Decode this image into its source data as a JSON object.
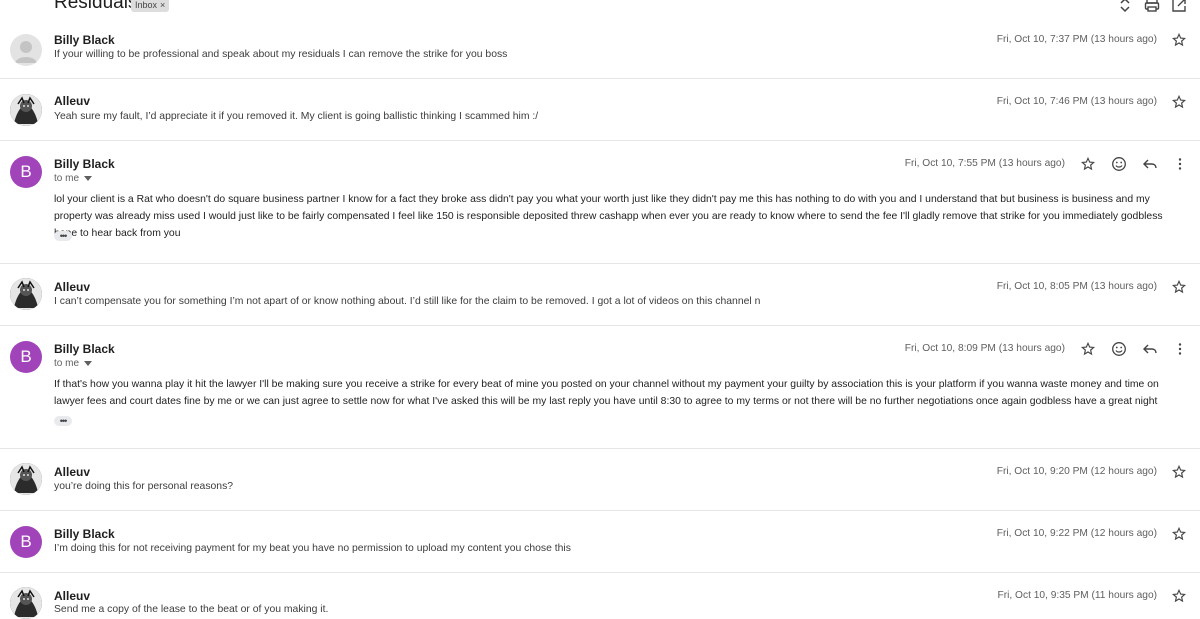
{
  "thread": {
    "subject": "Residuals",
    "label": "Inbox",
    "label_close": "×"
  },
  "icons": {
    "expand": "unfold-icon",
    "print": "print-icon",
    "open_new": "open-in-new-window-icon",
    "star": "star-outline-icon",
    "emoji": "emoji-reaction-icon",
    "reply": "reply-icon",
    "more": "more-vert-icon"
  },
  "messages": [
    {
      "sender": "Billy Black",
      "date": "Fri, Oct 10, 7:37 PM (13 hours ago)",
      "snippet": "If your willing to be professional and speak about my residuals I can remove the strike for you boss",
      "avatar": "default-avatar"
    },
    {
      "sender": "Alleuv",
      "date": "Fri, Oct 10, 7:46 PM (13 hours ago)",
      "snippet": "Yeah sure my fault, I’d appreciate it if you removed it. My client is going ballistic thinking I scammed him :/",
      "avatar": "photo-avatar"
    },
    {
      "sender": "Billy Black",
      "avatar_letter": "B",
      "date": "Fri, Oct 10, 7:55 PM (13 hours ago)",
      "to": "to me",
      "body": "lol your client is a Rat who doesn't do square business partner I know for a fact they broke ass didn't pay you what your worth just like they didn't pay me this has nothing to do with you and I understand that but business is business and my property was already miss used I would just like to be fairly compensated I feel like 150 is responsible deposited threw cashapp when ever you are ready to know where to send the fee I'll gladly remove that strike for you immediately godbless hope to hear back from you",
      "ellipsis": "•••"
    },
    {
      "sender": "Alleuv",
      "date": "Fri, Oct 10, 8:05 PM (13 hours ago)",
      "snippet": "I can’t compensate you for something I’m not apart of or know nothing about. I’d still like for the claim to be removed. I got a lot of videos on this channel n",
      "avatar": "photo-avatar"
    },
    {
      "sender": "Billy Black",
      "avatar_letter": "B",
      "date": "Fri, Oct 10, 8:09 PM (13 hours ago)",
      "to": "to me",
      "body": "If that's how you wanna play it hit the lawyer I'll be making sure you receive a strike for every beat of mine you posted on your channel without my payment your guilty by association this is your platform if you wanna waste money and time on lawyer fees and court dates fine by me or we can just agree to settle now for what I've asked this will be my last reply you have until 8:30 to agree to my terms or not there will be no further negotiations once again godbless have a great night",
      "ellipsis": "•••"
    },
    {
      "sender": "Alleuv",
      "date": "Fri, Oct 10, 9:20 PM (12 hours ago)",
      "snippet": "you’re doing this for personal reasons?",
      "avatar": "photo-avatar"
    },
    {
      "sender": "Billy Black",
      "avatar_letter": "B",
      "date": "Fri, Oct 10, 9:22 PM (12 hours ago)",
      "snippet": "I’m doing this for not receiving payment for my beat you have no permission to upload my content you chose this"
    },
    {
      "sender": "Alleuv",
      "date": "Fri, Oct 10, 9:35 PM (11 hours ago)",
      "snippet": "Send me a copy of the lease to the beat or of you making it.",
      "avatar": "photo-avatar"
    }
  ],
  "colors": {
    "avatar_purple": "#a143b9",
    "divider": "#e5e5e5",
    "date_text": "#5f5f5f"
  }
}
